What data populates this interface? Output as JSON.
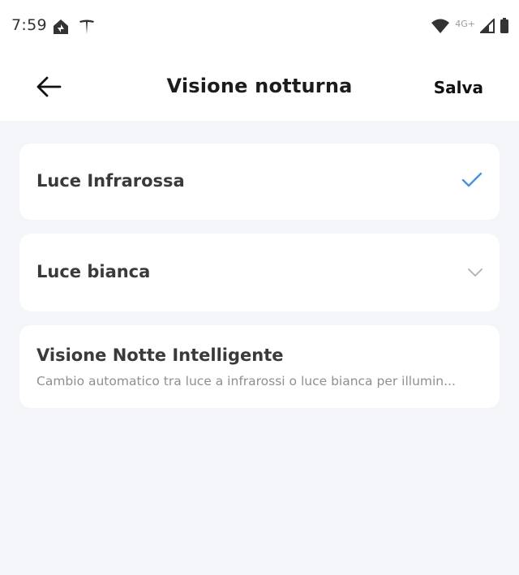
{
  "status_bar": {
    "time": "7:59",
    "network": "4G+",
    "icons": [
      "home-app-icon",
      "tesla-icon",
      "wifi-icon",
      "signal-icon",
      "battery-icon"
    ]
  },
  "header": {
    "title": "Visione notturna",
    "save_label": "Salva",
    "back_icon": "arrow-left-icon"
  },
  "options": [
    {
      "label": "Luce Infrarossa",
      "state": "selected",
      "icon": "checkmark-icon"
    },
    {
      "label": "Luce bianca",
      "state": "collapsed",
      "icon": "chevron-down-icon"
    },
    {
      "label": "Visione Notte Intelligente",
      "description": "Cambio automatico tra luce a infrarossi o luce bianca per illumin..."
    }
  ],
  "colors": {
    "accent": "#4a90e2",
    "background": "#f4f5f9",
    "card": "#ffffff"
  }
}
